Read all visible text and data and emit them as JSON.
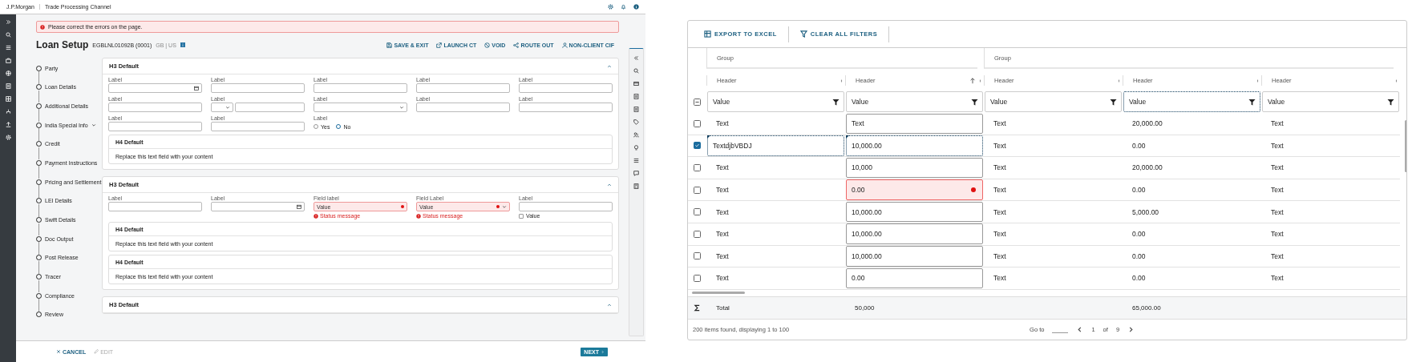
{
  "top_bar": {
    "brand": "J.P.Morgan",
    "app_title": "Trade Processing Channel"
  },
  "error_banner": "Please correct the errors on the page.",
  "page": {
    "title": "Loan Setup",
    "reference": "EGBLNL01092B (0001)",
    "region": "GB | US"
  },
  "actions": [
    {
      "label": "SAVE & EXIT",
      "kind": "save"
    },
    {
      "label": "LAUNCH CT",
      "kind": "launch"
    },
    {
      "label": "VOID",
      "kind": "void"
    },
    {
      "label": "ROUTE OUT",
      "kind": "route"
    },
    {
      "label": "NON-CLIENT CIF",
      "kind": "person"
    }
  ],
  "steps": [
    {
      "label": "Party",
      "expandable": false
    },
    {
      "label": "Loan Details",
      "expandable": false
    },
    {
      "label": "Additional Details",
      "expandable": false
    },
    {
      "label": "India Special Info",
      "expandable": true
    },
    {
      "label": "Credit",
      "expandable": false
    },
    {
      "label": "Payment Instructions",
      "expandable": false
    },
    {
      "label": "Pricing and Settlement",
      "expandable": false
    },
    {
      "label": "LEI Details",
      "expandable": false
    },
    {
      "label": "Swift Details",
      "expandable": false
    },
    {
      "label": "Doc Output",
      "expandable": false
    },
    {
      "label": "Post Release",
      "expandable": false
    },
    {
      "label": "Tracer",
      "expandable": false
    },
    {
      "label": "Compliance",
      "expandable": false
    },
    {
      "label": "Review",
      "expandable": false
    }
  ],
  "sections": [
    {
      "title": "H3 Default",
      "expanded": true,
      "rows": [
        [
          {
            "kind": "date",
            "label": "Label"
          },
          {
            "kind": "text",
            "label": "Label"
          },
          {
            "kind": "text",
            "label": "Label"
          },
          {
            "kind": "text",
            "label": "Label"
          },
          {
            "kind": "text",
            "label": "Label"
          }
        ],
        [
          {
            "kind": "text",
            "label": "Label"
          },
          {
            "kind": "split",
            "label": "Label"
          },
          {
            "kind": "select",
            "label": "Label"
          },
          {
            "kind": "text",
            "label": "Label"
          },
          {
            "kind": "text",
            "label": "Label"
          }
        ],
        [
          {
            "kind": "text",
            "label": "Label"
          },
          {
            "kind": "text",
            "label": "Label"
          },
          {
            "kind": "radio",
            "label": "Label",
            "options": [
              {
                "label": "Yes",
                "selected": false
              },
              {
                "label": "No",
                "selected": true
              }
            ]
          }
        ]
      ],
      "panels": [
        {
          "title": "H4 Default",
          "body": "Replace this text field with your content"
        }
      ]
    },
    {
      "title": "H3 Default",
      "expanded": true,
      "rows": [
        [
          {
            "kind": "text",
            "label": "Label"
          },
          {
            "kind": "date",
            "label": "Label"
          },
          {
            "kind": "text",
            "label": "Field label",
            "value": "Value",
            "error": true,
            "status": "Status message"
          },
          {
            "kind": "select",
            "label": "Field Label",
            "value": "Value",
            "error": true,
            "status": "Status message"
          },
          {
            "kind": "text",
            "label": "Label",
            "checkbox": {
              "label": "Value",
              "checked": false
            }
          }
        ]
      ],
      "panels": [
        {
          "title": "H4 Default",
          "body": "Replace this text field with your content"
        },
        {
          "title": "H4 Default",
          "body": "Replace this text field with your content"
        }
      ]
    },
    {
      "title": "H3 Default",
      "expanded": true
    }
  ],
  "footer": {
    "actions": [
      {
        "label": "CANCEL",
        "kind": "cancel",
        "disabled": false
      },
      {
        "label": "EDIT",
        "kind": "edit",
        "disabled": true
      }
    ],
    "next": "NEXT"
  },
  "grid": {
    "toolbar": [
      {
        "label": "EXPORT TO EXCEL",
        "kind": "export"
      },
      {
        "label": "CLEAR ALL FILTERS",
        "kind": "filter"
      }
    ],
    "partial_selection": true,
    "groups": [
      {
        "label": "Group",
        "columns": [
          {
            "header": "Header",
            "kind": "text",
            "sorted_ascending": false,
            "filter": "Value",
            "focused": false
          },
          {
            "header": "Header",
            "kind": "editable",
            "sorted_ascending": true,
            "filter": "Value",
            "focused": false,
            "total": "50,000"
          }
        ]
      },
      {
        "label": "Group",
        "columns": [
          {
            "header": "Header",
            "kind": "text",
            "sorted_ascending": false,
            "filter": "Value",
            "focused": false
          },
          {
            "header": "Header",
            "kind": "text",
            "sorted_ascending": false,
            "filter": "Value",
            "focused": true,
            "total": "65,000.00"
          },
          {
            "header": "Header",
            "kind": "text",
            "sorted_ascending": false,
            "filter": "Value",
            "focused": false
          }
        ]
      }
    ],
    "rows": [
      {
        "selected": false,
        "editing": false,
        "cells": [
          {
            "text": "Text"
          },
          {
            "text": "Text",
            "error": false
          },
          {
            "text": "Text"
          },
          {
            "text": "20,000.00"
          },
          {
            "text": "Text"
          }
        ]
      },
      {
        "selected": true,
        "editing": true,
        "cells": [
          {
            "text": "TextdjbVBDJ"
          },
          {
            "text": "10,000.00",
            "error": false
          },
          {
            "text": "Text"
          },
          {
            "text": "0.00"
          },
          {
            "text": "Text"
          }
        ]
      },
      {
        "selected": false,
        "editing": false,
        "cells": [
          {
            "text": "Text"
          },
          {
            "text": "10,000",
            "error": false
          },
          {
            "text": "Text"
          },
          {
            "text": "20,000.00"
          },
          {
            "text": "Text"
          }
        ]
      },
      {
        "selected": false,
        "editing": false,
        "cells": [
          {
            "text": "Text"
          },
          {
            "text": "0.00",
            "error": true
          },
          {
            "text": "Text"
          },
          {
            "text": "0.00"
          },
          {
            "text": "Text"
          }
        ]
      },
      {
        "selected": false,
        "editing": false,
        "cells": [
          {
            "text": "Text"
          },
          {
            "text": "10,000.00",
            "error": false
          },
          {
            "text": "Text"
          },
          {
            "text": "5,000.00"
          },
          {
            "text": "Text"
          }
        ]
      },
      {
        "selected": false,
        "editing": false,
        "cells": [
          {
            "text": "Text"
          },
          {
            "text": "10,000.00",
            "error": false
          },
          {
            "text": "Text"
          },
          {
            "text": "0.00"
          },
          {
            "text": "Text"
          }
        ]
      },
      {
        "selected": false,
        "editing": false,
        "cells": [
          {
            "text": "Text"
          },
          {
            "text": "10,000.00",
            "error": false
          },
          {
            "text": "Text"
          },
          {
            "text": "0.00"
          },
          {
            "text": "Text"
          }
        ]
      },
      {
        "selected": false,
        "editing": false,
        "cells": [
          {
            "text": "Text"
          },
          {
            "text": "0.00",
            "error": false
          },
          {
            "text": "Text"
          },
          {
            "text": "0.00"
          },
          {
            "text": "Text"
          }
        ]
      }
    ],
    "total_label": "Total",
    "summary": "200 items found, displaying 1 to 100",
    "pagination": {
      "goto_label": "Go to",
      "page": "1",
      "of_label": "of",
      "pages": "9"
    }
  }
}
